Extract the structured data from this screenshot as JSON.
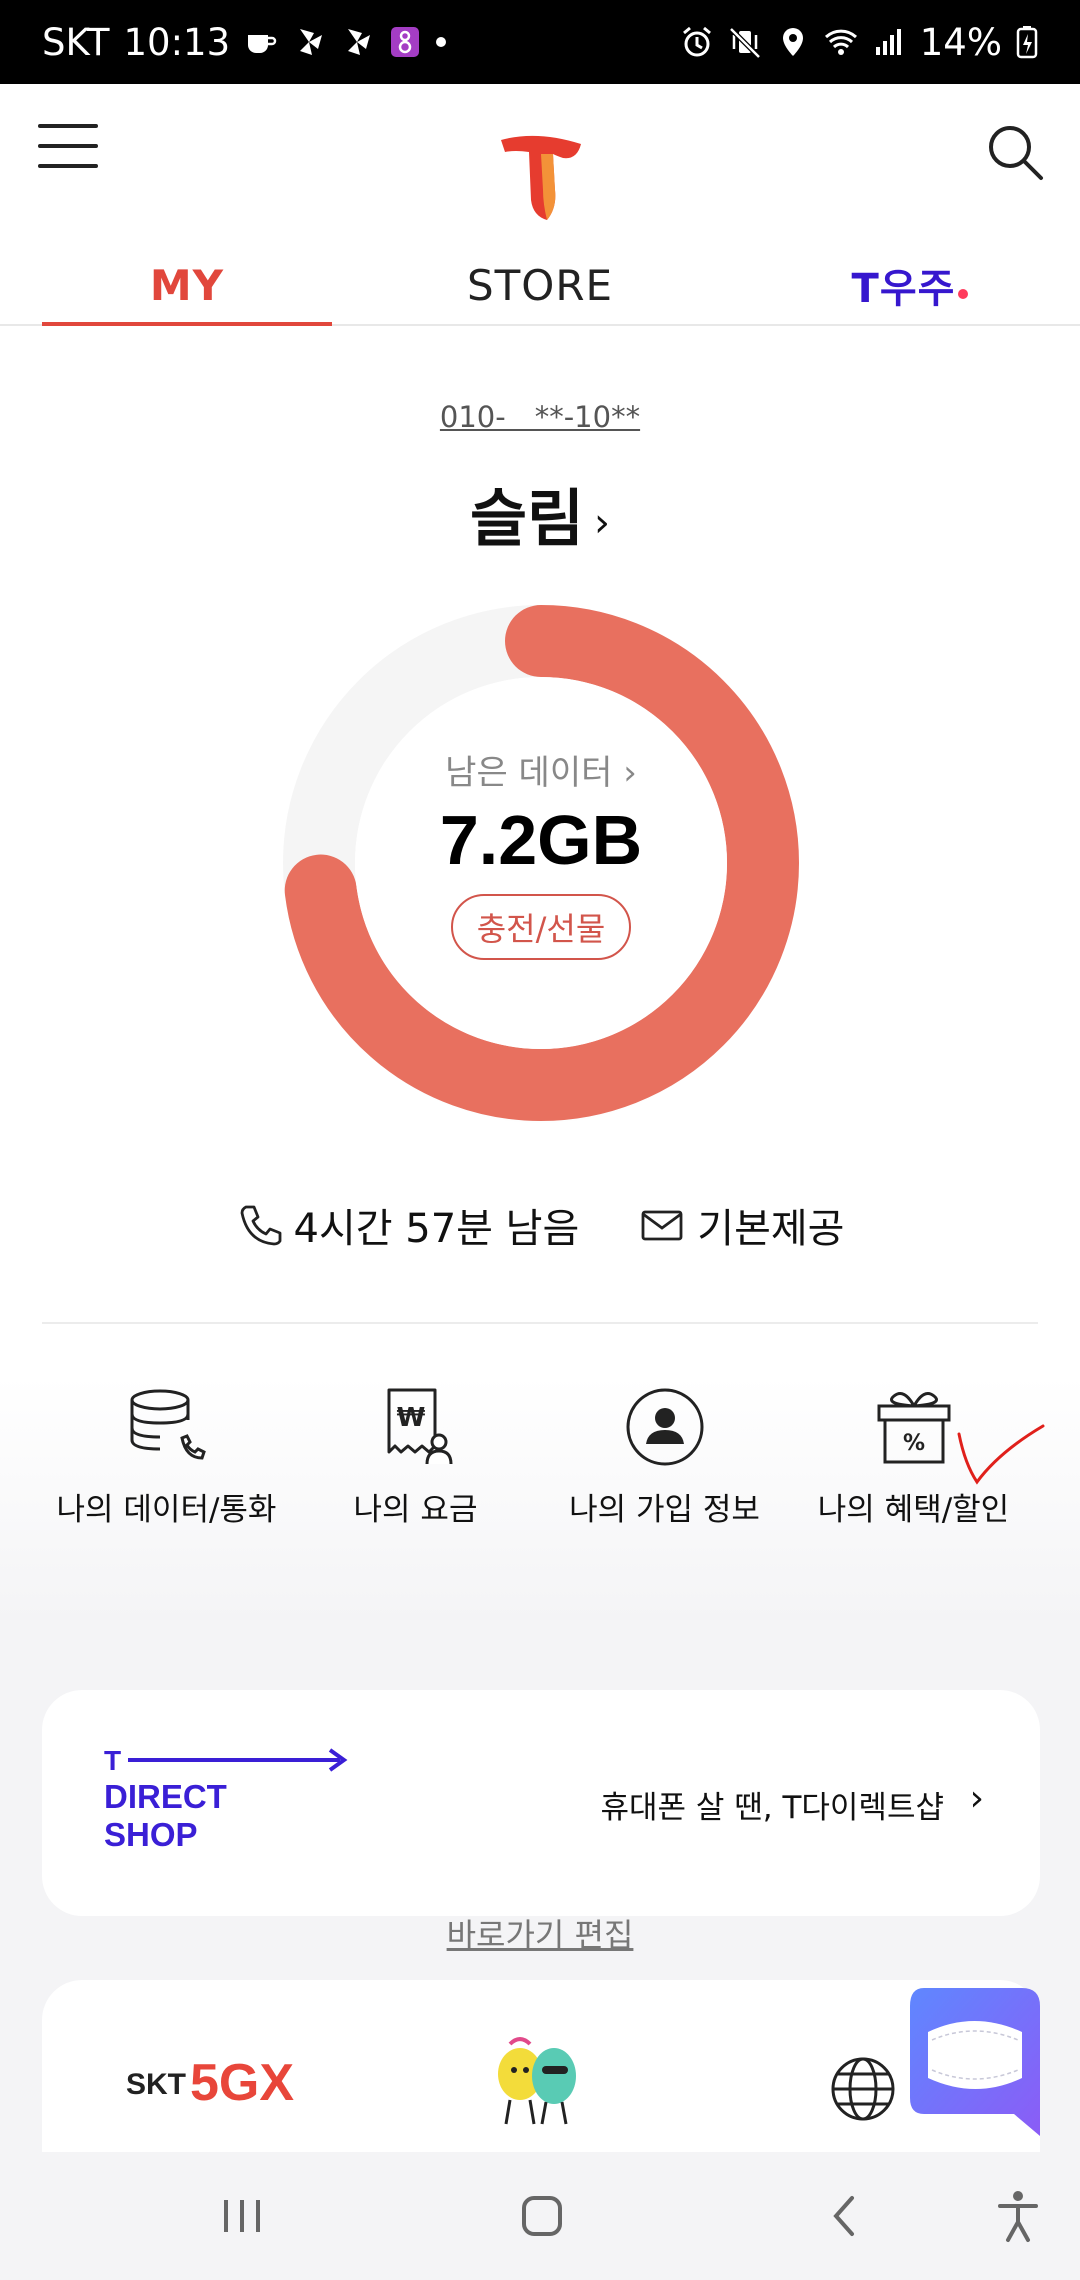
{
  "status_bar": {
    "carrier": "SKT",
    "time": "10:13",
    "battery": "14%"
  },
  "header": {
    "tabs": [
      {
        "label": "MY",
        "active": true
      },
      {
        "label": "STORE",
        "active": false
      },
      {
        "label": "T우주",
        "active": false
      }
    ]
  },
  "account": {
    "phone_number": "010-　**-10**",
    "plan_name": "슬림",
    "plan_chevron": "›"
  },
  "data_usage": {
    "label": "남은 데이터",
    "label_chevron": "›",
    "value": "7.2GB",
    "remaining_fraction": 0.73,
    "charge_button": "충전/선물",
    "accent_color": "#e8705f"
  },
  "usage_summary": {
    "call_remaining": "4시간 57분 남음",
    "sms": "기본제공"
  },
  "shortcuts": [
    {
      "label": "나의 데이터/통화",
      "icon": "data-call-icon"
    },
    {
      "label": "나의 요금",
      "icon": "bill-icon"
    },
    {
      "label": "나의 가입 정보",
      "icon": "profile-icon"
    },
    {
      "label": "나의 혜택/할인",
      "icon": "gift-discount-icon"
    }
  ],
  "edit_shortcuts": "바로가기 편집",
  "direct_shop": {
    "logo_lines": [
      "T",
      "DIRECT",
      "SHOP"
    ],
    "text": "휴대폰 살 땐, T다이렉트샵",
    "chevron": "›"
  },
  "menu_card": {
    "skt_text": "SKT",
    "fivegx_text": "5GX"
  }
}
